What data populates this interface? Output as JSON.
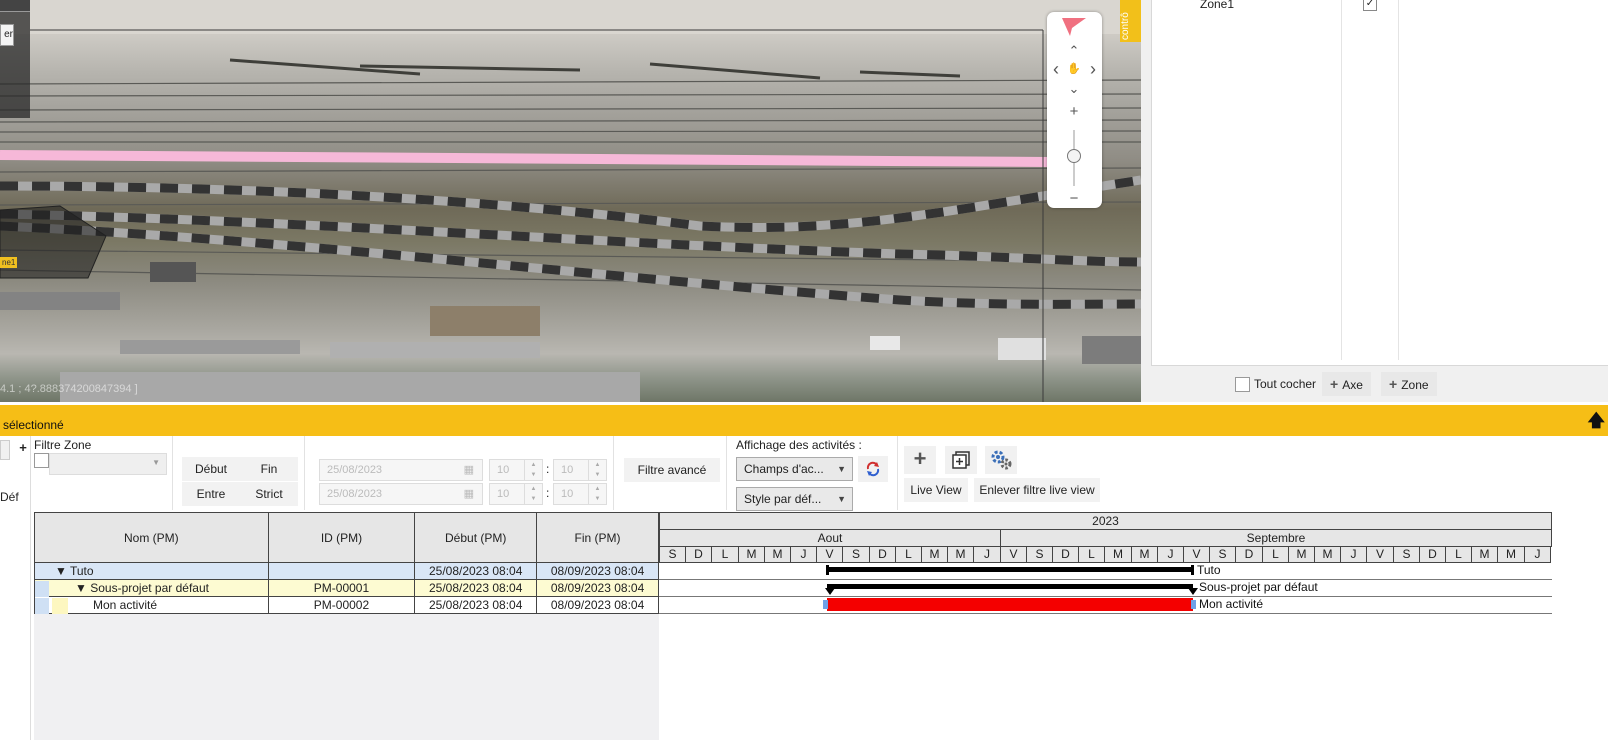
{
  "map": {
    "coord_text": "4.1 ; 4?.888374200847394 ]",
    "zone_tag": "ne1",
    "mini_btn_text": "er",
    "control_tab": "contrô",
    "nav": {
      "up": "⌃",
      "left": "‹",
      "right": "›",
      "down": "⌄",
      "pan": "✋",
      "zoom_in": "+",
      "zoom_out": "−"
    }
  },
  "rightpanel": {
    "zone_name": "Zone1",
    "zone_checked": "✓",
    "tout_cocher": "Tout cocher",
    "axe_btn": "Axe",
    "zone_btn": "Zone",
    "plus": "+"
  },
  "ybar": {
    "title": "sélectionné",
    "collapse_icon": "🡅"
  },
  "toolbar": {
    "left_plus": "+",
    "left_def": "Déf",
    "filtre_zone": "Filtre Zone",
    "debut": "Début",
    "fin": "Fin",
    "entre": "Entre",
    "strict": "Strict",
    "date1": "25/08/2023",
    "date2": "25/08/2023",
    "h1": "10",
    "m1": "10",
    "h2": "10",
    "m2": "10",
    "colon": ":",
    "filtre_avance": "Filtre avancé",
    "affichage": "Affichage des activités :",
    "champs": "Champs d'ac...",
    "style": "Style par déf...",
    "live_view": "Live View",
    "enlever": "Enlever filtre live view"
  },
  "grid": {
    "columns": [
      "Nom (PM)",
      "ID (PM)",
      "Début (PM)",
      "Fin (PM)"
    ],
    "rows": [
      {
        "prefix": "▼ ",
        "name": "Tuto",
        "id": "",
        "debut": "25/08/2023 08:04",
        "fin": "08/09/2023 08:04"
      },
      {
        "prefix": "▼ ",
        "name": "Sous-projet par défaut",
        "id": "PM-00001",
        "debut": "25/08/2023 08:04",
        "fin": "08/09/2023 08:04"
      },
      {
        "prefix": "",
        "name": "Mon activité",
        "id": "PM-00002",
        "debut": "25/08/2023 08:04",
        "fin": "08/09/2023 08:04"
      }
    ]
  },
  "gantt": {
    "year": "2023",
    "months": [
      "Aout",
      "Septembre"
    ],
    "days": [
      "S",
      "D",
      "L",
      "M",
      "M",
      "J",
      "V",
      "S",
      "D",
      "L",
      "M",
      "M",
      "J",
      "V",
      "S",
      "D",
      "L",
      "M",
      "M",
      "J",
      "V",
      "S",
      "D",
      "L",
      "M",
      "M",
      "J",
      "V",
      "S",
      "D",
      "L",
      "M",
      "M",
      "J"
    ],
    "bar_labels": [
      "Tuto",
      "Sous-projet par défaut",
      "Mon activité"
    ],
    "accent_red": "#f40000",
    "brand_yellow": "#f6be16"
  }
}
